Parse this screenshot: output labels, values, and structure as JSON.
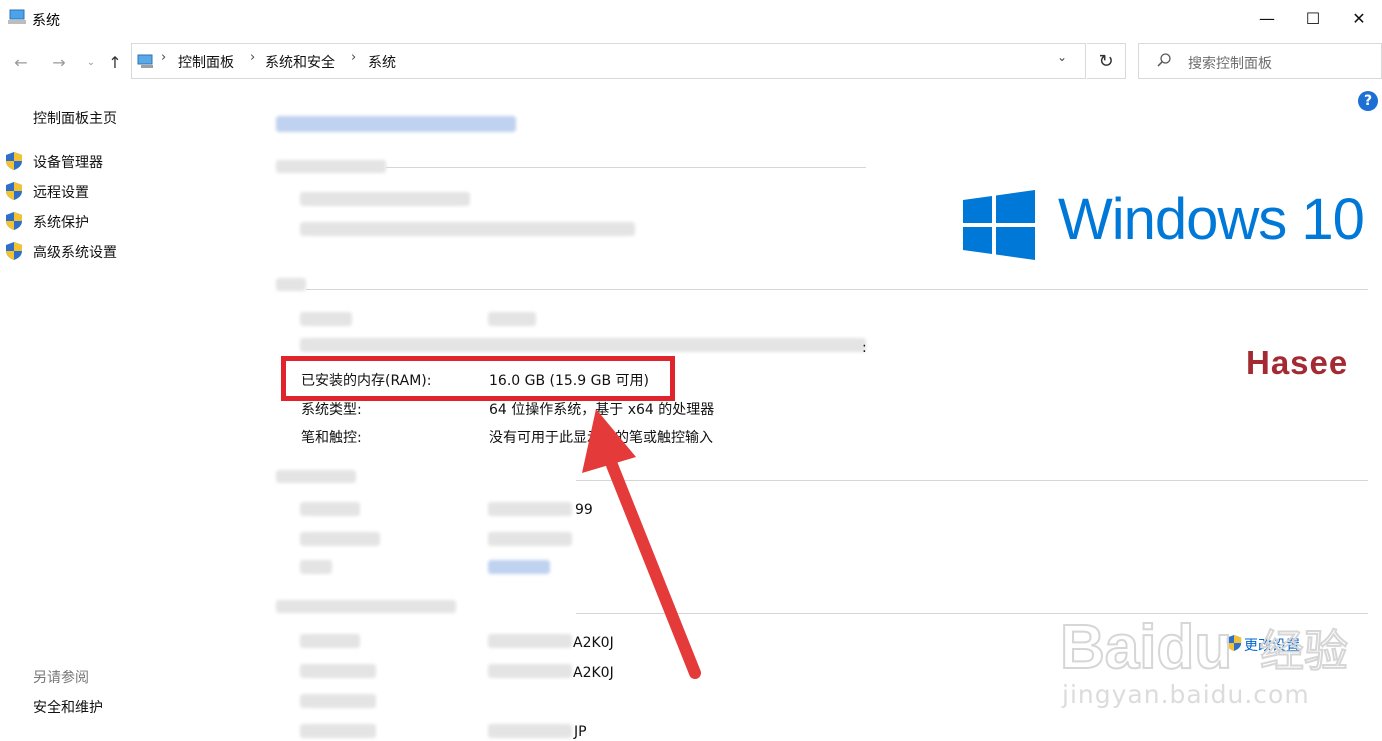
{
  "window": {
    "title": "系统"
  },
  "address_bar": {
    "crumbs": [
      "控制面板",
      "系统和安全",
      "系统"
    ],
    "search_placeholder": "搜索控制面板"
  },
  "sidebar": {
    "home": "控制面板主页",
    "items": [
      {
        "label": "设备管理器",
        "icon": "uac-shield-icon"
      },
      {
        "label": "远程设置",
        "icon": "uac-shield-icon"
      },
      {
        "label": "系统保护",
        "icon": "uac-shield-icon"
      },
      {
        "label": "高级系统设置",
        "icon": "uac-shield-icon"
      }
    ],
    "see_also_heading": "另请参阅",
    "see_also_items": [
      "安全和维护"
    ]
  },
  "system": {
    "logo_text": "Windows 10",
    "oem_logo_text": "Hasee",
    "ram": {
      "label": "已安装的内存(RAM):",
      "value": "16.0 GB (15.9 GB 可用)"
    },
    "system_type": {
      "label": "系统类型:",
      "value": "64 位操作系统，基于 x64 的处理器"
    },
    "pen_touch": {
      "label": "笔和触控:",
      "value": "没有可用于此显示器的笔或触控输入"
    },
    "fragments": [
      "99",
      "A2K0J",
      "A2K0J",
      "JP",
      ":"
    ],
    "change_settings": "更改设置"
  },
  "watermark": {
    "brand": "Baidu",
    "brand_cn": "经验",
    "url": "jingyan.baidu.com"
  },
  "colors": {
    "accent": "#0078d7",
    "highlight": "#e0242b",
    "oem_red": "#a32a33"
  }
}
